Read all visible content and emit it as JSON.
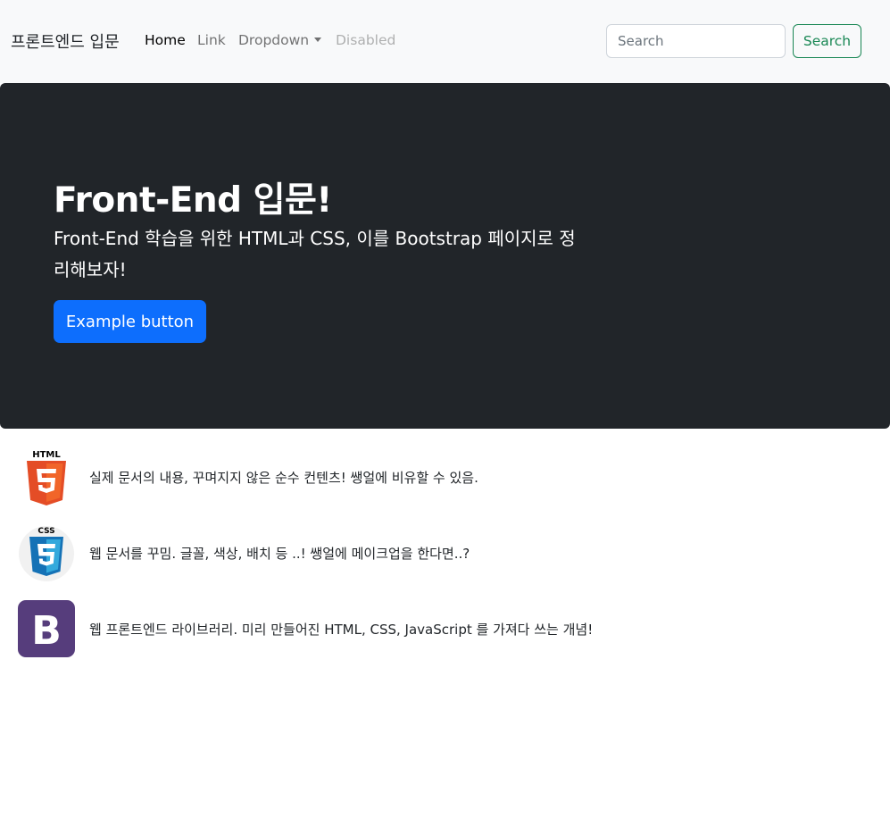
{
  "navbar": {
    "brand": "프론트엔드 입문",
    "links": [
      {
        "label": "Home"
      },
      {
        "label": "Link"
      },
      {
        "label": "Dropdown"
      },
      {
        "label": "Disabled"
      }
    ],
    "search_placeholder": "Search",
    "search_button": "Search"
  },
  "hero": {
    "title": "Front-End 입문!",
    "text": "Front-End 학습을 위한 HTML과 CSS, 이를 Bootstrap 페이지로 정리해보자!",
    "button": "Example button"
  },
  "features": [
    {
      "icon": "html5-logo-icon",
      "logo_text": "HTML",
      "text": "실제 문서의 내용, 꾸며지지 않은 순수 컨텐츠! 쌩얼에 비유할 수 있음."
    },
    {
      "icon": "css3-logo-icon",
      "logo_text": "CSS",
      "text": "웹 문서를 꾸밈. 글꼴, 색상, 배치 등 ..! 쌩얼에 메이크업을 한다면..?"
    },
    {
      "icon": "bootstrap-logo-icon",
      "logo_text": "B",
      "text": "웹 프론트엔드 라이브러리. 미리 만들어진 HTML, CSS, JavaScript 를 가져다 쓰는 개념!"
    }
  ],
  "colors": {
    "navbar_bg": "#f8f9fa",
    "hero_bg": "#212529",
    "primary": "#0d6efd",
    "success": "#198754",
    "html_orange": "#e44d26",
    "css_blue": "#1572b6",
    "bootstrap_purple": "#563d7c"
  }
}
